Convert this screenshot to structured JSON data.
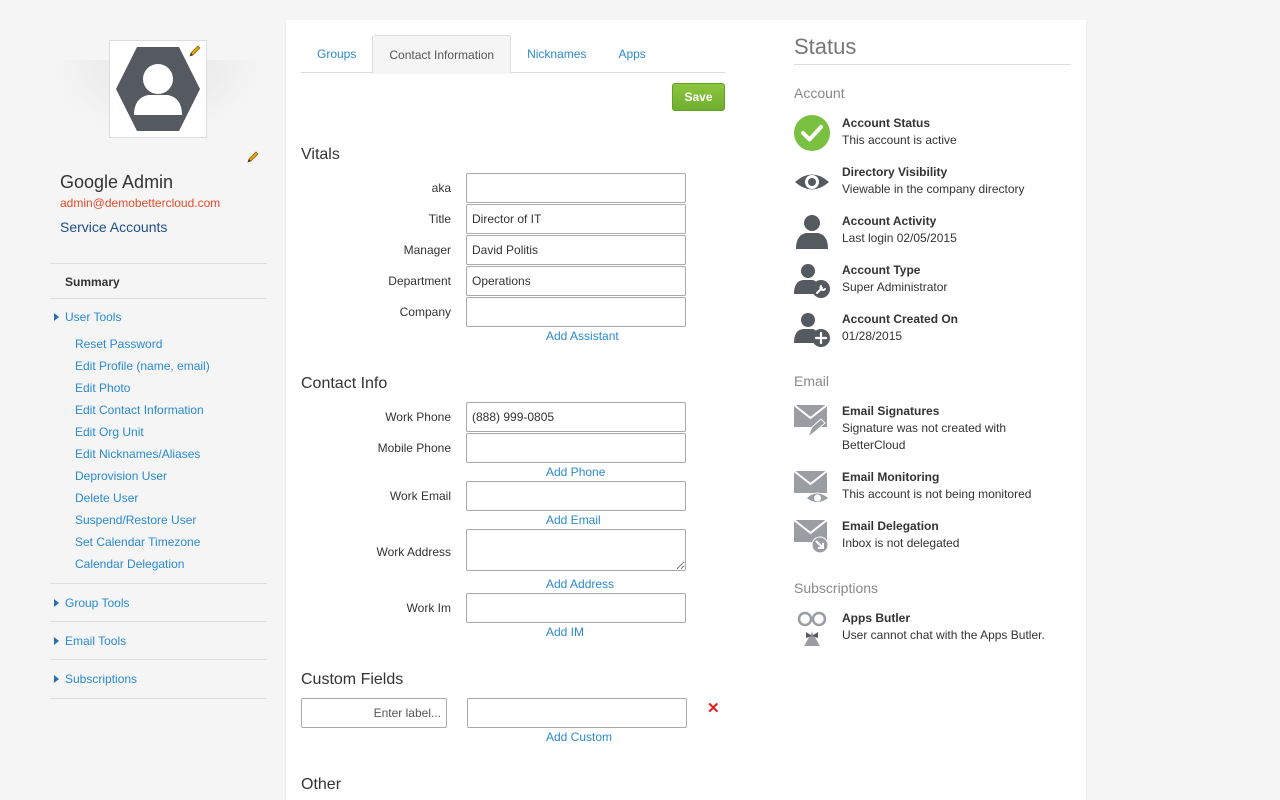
{
  "profile": {
    "name": "Google Admin",
    "email": "admin@demobettercloud.com",
    "service_accounts": "Service Accounts"
  },
  "sidebar": {
    "summary": "Summary",
    "user_tools": {
      "label": "User Tools",
      "items": [
        "Reset Password",
        "Edit Profile (name, email)",
        "Edit Photo",
        "Edit Contact Information",
        "Edit Org Unit",
        "Edit Nicknames/Aliases",
        "Deprovision User",
        "Delete User",
        "Suspend/Restore User",
        "Set Calendar Timezone",
        "Calendar Delegation"
      ]
    },
    "group_tools": "Group Tools",
    "email_tools": "Email Tools",
    "subscriptions": "Subscriptions"
  },
  "tabs": [
    "Groups",
    "Contact Information",
    "Nicknames",
    "Apps"
  ],
  "save_label": "Save",
  "vitals": {
    "title": "Vitals",
    "fields": [
      {
        "label": "aka",
        "value": ""
      },
      {
        "label": "Title",
        "value": "Director of IT"
      },
      {
        "label": "Manager",
        "value": "David Politis"
      },
      {
        "label": "Department",
        "value": "Operations"
      },
      {
        "label": "Company",
        "value": ""
      }
    ],
    "add_assistant": "Add Assistant"
  },
  "contact": {
    "title": "Contact Info",
    "work_phone": {
      "label": "Work Phone",
      "value": "(888) 999-0805"
    },
    "mobile_phone": {
      "label": "Mobile Phone",
      "value": ""
    },
    "add_phone": "Add Phone",
    "work_email": {
      "label": "Work Email",
      "value": ""
    },
    "add_email": "Add Email",
    "work_address": {
      "label": "Work Address",
      "value": ""
    },
    "add_address": "Add Address",
    "work_im": {
      "label": "Work Im",
      "value": ""
    },
    "add_im": "Add IM"
  },
  "custom": {
    "title": "Custom Fields",
    "label_placeholder": "Enter label...",
    "value": "",
    "add_custom": "Add Custom"
  },
  "other": {
    "title": "Other"
  },
  "status": {
    "title": "Status",
    "account": {
      "title": "Account",
      "items": [
        {
          "head": "Account Status",
          "desc": "This account is active",
          "icon": "check-circle-icon"
        },
        {
          "head": "Directory Visibility",
          "desc": "Viewable in the company directory",
          "icon": "eye-icon"
        },
        {
          "head": "Account Activity",
          "desc": "Last login 02/05/2015",
          "icon": "user-icon"
        },
        {
          "head": "Account Type",
          "desc": "Super Administrator",
          "icon": "user-wrench-icon"
        },
        {
          "head": "Account Created On",
          "desc": "01/28/2015",
          "icon": "user-add-icon"
        }
      ]
    },
    "email": {
      "title": "Email",
      "items": [
        {
          "head": "Email Signatures",
          "desc": "Signature was not created with BetterCloud",
          "icon": "mail-pen-icon"
        },
        {
          "head": "Email Monitoring",
          "desc": "This account is not being monitored",
          "icon": "mail-eye-icon"
        },
        {
          "head": "Email Delegation",
          "desc": "Inbox is not delegated",
          "icon": "mail-forward-icon"
        }
      ]
    },
    "subscriptions": {
      "title": "Subscriptions",
      "items": [
        {
          "head": "Apps Butler",
          "desc": "User cannot chat with the Apps Butler.",
          "icon": "butler-icon"
        }
      ]
    }
  },
  "colors": {
    "link": "#2a8ad4",
    "email_red": "#e54b2b",
    "save_green": "#7ab833",
    "status_check_green": "#7ac142",
    "icon_gray": "#555a60"
  }
}
